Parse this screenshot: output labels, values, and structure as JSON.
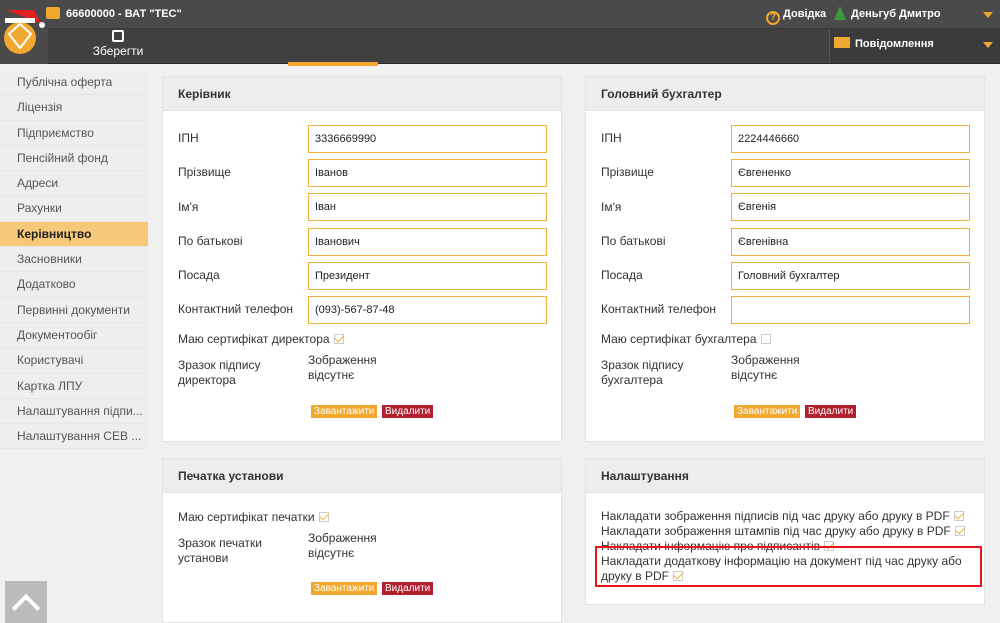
{
  "header": {
    "company": "66600000 - ВАТ \"ТЕС\"",
    "help": "Довідка",
    "user": "Деньгуб Дмитро",
    "save": "Зберегти",
    "messages": "Повідомлення"
  },
  "sidebar": {
    "items": [
      {
        "label": "Публічна оферта"
      },
      {
        "label": "Ліцензія"
      },
      {
        "label": "Підприємство"
      },
      {
        "label": "Пенсійний фонд"
      },
      {
        "label": "Адреси"
      },
      {
        "label": "Рахунки"
      },
      {
        "label": "Керівництво",
        "active": true
      },
      {
        "label": "Засновники"
      },
      {
        "label": "Додатково"
      },
      {
        "label": "Первинні документи"
      },
      {
        "label": "Документообіг"
      },
      {
        "label": "Користувачі"
      },
      {
        "label": "Картка ЛПУ"
      },
      {
        "label": "Налаштування підпи..."
      },
      {
        "label": "Налаштування СЕВ ..."
      }
    ]
  },
  "director": {
    "title": "Керівник",
    "labels": {
      "ipn": "ІПН",
      "surname": "Прізвище",
      "name": "Ім'я",
      "patronymic": "По батькові",
      "position": "Посада",
      "phone": "Контактний телефон",
      "cert": "Маю сертифікат директора",
      "sign": "Зразок підпису директора"
    },
    "values": {
      "ipn": "3336669990",
      "surname": "Іванов",
      "name": "Іван",
      "patronymic": "Іванович",
      "position": "Президент",
      "phone": "(093)-567-87-48"
    },
    "cert_checked": true,
    "image_status": "Зображення відсутнє",
    "upload": "Завантажити",
    "delete": "Видалити"
  },
  "accountant": {
    "title": "Головний бухгалтер",
    "labels": {
      "ipn": "ІПН",
      "surname": "Прізвище",
      "name": "Ім'я",
      "patronymic": "По батькові",
      "position": "Посада",
      "phone": "Контактний телефон",
      "cert": "Маю сертифікат бухгалтера",
      "sign": "Зразок підпису бухгалтера"
    },
    "values": {
      "ipn": "2224446660",
      "surname": "Євгененко",
      "name": "Євгенія",
      "patronymic": "Євгенівна",
      "position": "Головний бухгалтер",
      "phone": ""
    },
    "cert_checked": false,
    "image_status": "Зображення відсутнє",
    "upload": "Завантажити",
    "delete": "Видалити"
  },
  "stamp": {
    "title": "Печатка установи",
    "cert": "Маю сертифікат печатки",
    "sample": "Зразок печатки установи",
    "image_status": "Зображення відсутнє",
    "upload": "Завантажити",
    "delete": "Видалити"
  },
  "settings": {
    "title": "Налаштування",
    "items": [
      "Накладати зображення підписів під час друку або друку в PDF",
      "Накладати зображення штампів під час друку або друку в PDF",
      "Накладати інформацію про підписантів",
      "Накладати додаткову інформацію на документ під час друку або друку в PDF"
    ]
  },
  "colors": {
    "accent": "#f0a830",
    "delete": "#b21f2d",
    "highlight": "#e8141a"
  }
}
